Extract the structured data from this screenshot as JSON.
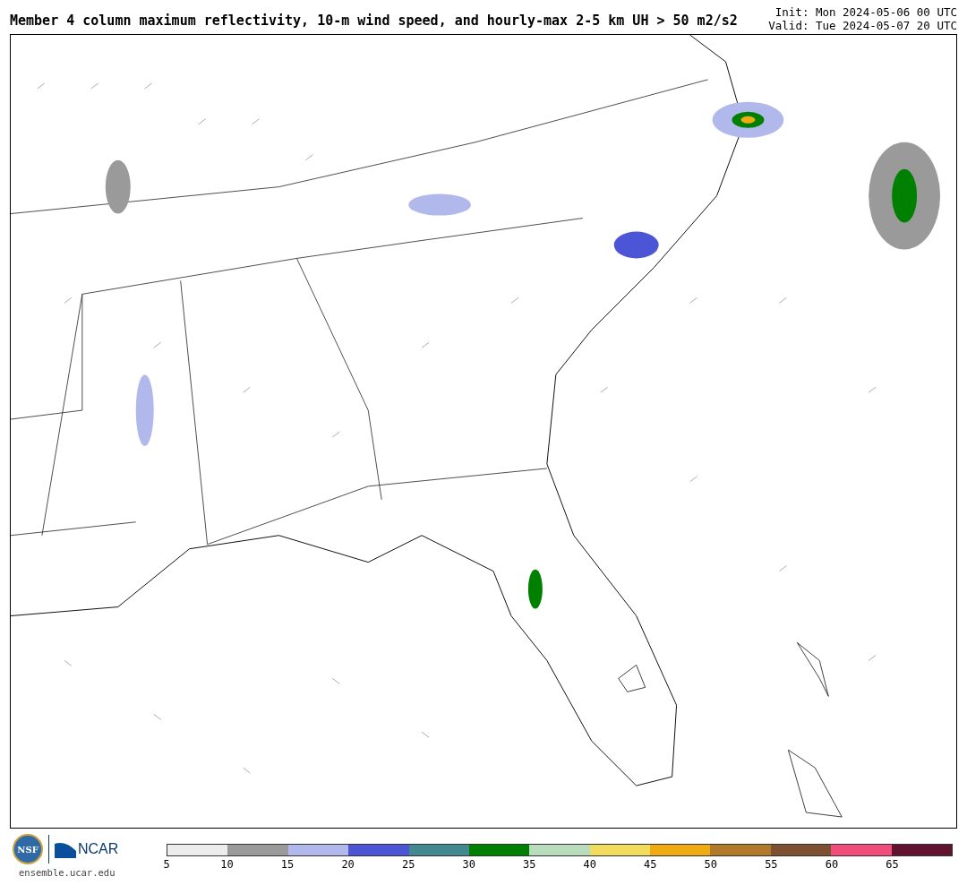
{
  "title": "Member 4 column maximum reflectivity, 10-m wind speed, and hourly-max 2-5 km UH > 50 m2/s2",
  "init": "Init: Mon 2024-05-06 00 UTC",
  "valid": "Valid: Tue 2024-05-07 20 UTC",
  "logos": {
    "nsf": "NSF",
    "ncar": "NCAR",
    "site": "ensemble.ucar.edu"
  },
  "colorbar": {
    "bins": [
      {
        "color": "#ececec"
      },
      {
        "color": "#9a9a9a"
      },
      {
        "color": "#b1b9ec"
      },
      {
        "color": "#4b55d6"
      },
      {
        "color": "#42888f"
      },
      {
        "color": "#008000"
      },
      {
        "color": "#b9dcbd"
      },
      {
        "color": "#f1dc5c"
      },
      {
        "color": "#f0aa12"
      },
      {
        "color": "#b07a2a"
      },
      {
        "color": "#7e5032"
      },
      {
        "color": "#f04c7c"
      },
      {
        "color": "#62122e"
      }
    ],
    "labels": [
      "5",
      "10",
      "15",
      "20",
      "25",
      "30",
      "35",
      "40",
      "45",
      "50",
      "55",
      "60",
      "65"
    ]
  }
}
